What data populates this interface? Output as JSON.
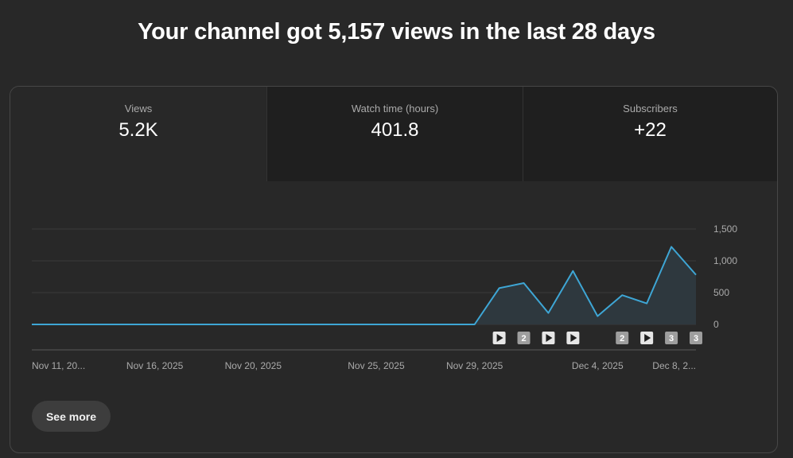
{
  "headline": "Your channel got 5,157 views in the last 28 days",
  "tabs": [
    {
      "label": "Views",
      "value": "5.2K",
      "active": true
    },
    {
      "label": "Watch time (hours)",
      "value": "401.8",
      "active": false
    },
    {
      "label": "Subscribers",
      "value": "+22",
      "active": false
    }
  ],
  "see_more_label": "See more",
  "colors": {
    "line": "#3ea6d5",
    "fill": "#2f3a40",
    "grid": "#3a3a3a"
  },
  "chart_data": {
    "type": "area",
    "series": [
      {
        "values": [
          0,
          0,
          0,
          0,
          0,
          0,
          0,
          0,
          0,
          0,
          0,
          0,
          0,
          0,
          0,
          0,
          0,
          0,
          0,
          570,
          650,
          180,
          840,
          130,
          460,
          330,
          1220,
          780
        ]
      }
    ],
    "ylim": [
      0,
      1500
    ],
    "yticks": [
      "0",
      "500",
      "1,000",
      "1,500"
    ],
    "ytick_values": [
      0,
      500,
      1000,
      1500
    ],
    "x_tick_labels": [
      {
        "index": 0,
        "label": "Nov 11, 20..."
      },
      {
        "index": 5,
        "label": "Nov 16, 2025"
      },
      {
        "index": 9,
        "label": "Nov 20, 2025"
      },
      {
        "index": 14,
        "label": "Nov 25, 2025"
      },
      {
        "index": 18,
        "label": "Nov 29, 2025"
      },
      {
        "index": 23,
        "label": "Dec 4, 2025"
      },
      {
        "index": 27,
        "label": "Dec 8, 2..."
      }
    ],
    "markers": [
      {
        "index": 19,
        "type": "play"
      },
      {
        "index": 20,
        "type": "count",
        "text": "2"
      },
      {
        "index": 21,
        "type": "play"
      },
      {
        "index": 22,
        "type": "play"
      },
      {
        "index": 24,
        "type": "count",
        "text": "2"
      },
      {
        "index": 25,
        "type": "play"
      },
      {
        "index": 26,
        "type": "count",
        "text": "3"
      },
      {
        "index": 27,
        "type": "count",
        "text": "3"
      }
    ]
  }
}
